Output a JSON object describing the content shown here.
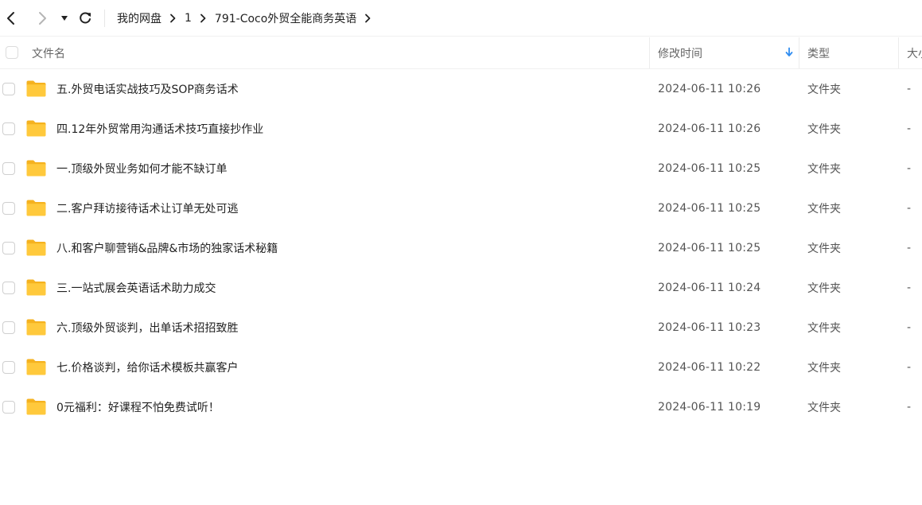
{
  "toolbar": {
    "back_icon": "chevron-left-icon",
    "forward_icon": "chevron-right-icon",
    "history_icon": "caret-down-icon",
    "refresh_icon": "refresh-icon"
  },
  "breadcrumb": [
    {
      "label": "我的网盘"
    },
    {
      "label": "1"
    },
    {
      "label": "791-Coco外贸全能商务英语"
    }
  ],
  "columns": {
    "name": "文件名",
    "modified": "修改时间",
    "type": "类型",
    "size": "大小"
  },
  "files": [
    {
      "name": "五.外贸电话实战技巧及SOP商务话术",
      "modified": "2024-06-11 10:26",
      "type": "文件夹",
      "size": "-"
    },
    {
      "name": "四.12年外贸常用沟通话术技巧直接抄作业",
      "modified": "2024-06-11 10:26",
      "type": "文件夹",
      "size": "-"
    },
    {
      "name": "一.顶级外贸业务如何才能不缺订单",
      "modified": "2024-06-11 10:25",
      "type": "文件夹",
      "size": "-"
    },
    {
      "name": "二.客户拜访接待话术让订单无处可逃",
      "modified": "2024-06-11 10:25",
      "type": "文件夹",
      "size": "-"
    },
    {
      "name": "八.和客户聊营销&品牌&市场的独家话术秘籍",
      "modified": "2024-06-11 10:25",
      "type": "文件夹",
      "size": "-"
    },
    {
      "name": "三.一站式展会英语话术助力成交",
      "modified": "2024-06-11 10:24",
      "type": "文件夹",
      "size": "-"
    },
    {
      "name": "六.顶级外贸谈判，出单话术招招致胜",
      "modified": "2024-06-11 10:23",
      "type": "文件夹",
      "size": "-"
    },
    {
      "name": "七.价格谈判，给你话术模板共赢客户",
      "modified": "2024-06-11 10:22",
      "type": "文件夹",
      "size": "-"
    },
    {
      "name": "0元福利：好课程不怕免费试听！",
      "modified": "2024-06-11 10:19",
      "type": "文件夹",
      "size": "-"
    }
  ],
  "colors": {
    "folder": "#FFC93C",
    "folder_tab": "#F5B21F",
    "sort_arrow": "#2F8CF0"
  }
}
